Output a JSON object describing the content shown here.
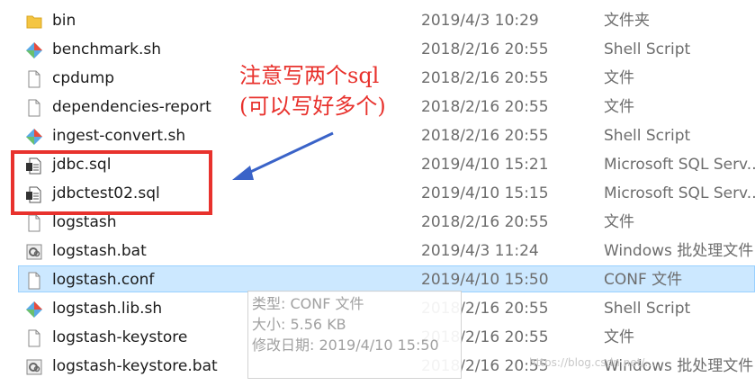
{
  "files": [
    {
      "name": "bin",
      "date": "2019/4/3 10:29",
      "type": "文件夹",
      "icon": "folder-icon"
    },
    {
      "name": "benchmark.sh",
      "date": "2018/2/16 20:55",
      "type": "Shell Script",
      "icon": "shell-script-icon"
    },
    {
      "name": "cpdump",
      "date": "2018/2/16 20:55",
      "type": "文件",
      "icon": "file-icon"
    },
    {
      "name": "dependencies-report",
      "date": "2018/2/16 20:55",
      "type": "文件",
      "icon": "file-icon"
    },
    {
      "name": "ingest-convert.sh",
      "date": "2018/2/16 20:55",
      "type": "Shell Script",
      "icon": "shell-script-icon"
    },
    {
      "name": "jdbc.sql",
      "date": "2019/4/10 15:21",
      "type": "Microsoft SQL Serv...",
      "icon": "sql-file-icon"
    },
    {
      "name": "jdbctest02.sql",
      "date": "2019/4/10 15:15",
      "type": "Microsoft SQL Serv...",
      "icon": "sql-file-icon"
    },
    {
      "name": "logstash",
      "date": "2018/2/16 20:55",
      "type": "文件",
      "icon": "file-icon"
    },
    {
      "name": "logstash.bat",
      "date": "2019/4/3 11:24",
      "type": "Windows 批处理文件",
      "icon": "batch-file-icon"
    },
    {
      "name": "logstash.conf",
      "date": "2019/4/10 15:50",
      "type": "CONF 文件",
      "icon": "file-icon",
      "selected": true
    },
    {
      "name": "logstash.lib.sh",
      "date": "2018/2/16 20:55",
      "type": "Shell Script",
      "icon": "shell-script-icon"
    },
    {
      "name": "logstash-keystore",
      "date": "2018/2/16 20:55",
      "type": "文件",
      "icon": "file-icon"
    },
    {
      "name": "logstash-keystore.bat",
      "date": "2018/2/16 20:55",
      "type": "Windows 批处理文件",
      "icon": "batch-file-icon"
    }
  ],
  "annotation": {
    "line1": "注意写两个sql",
    "line2": "(可以写好多个)"
  },
  "tooltip": {
    "type": "类型: CONF 文件",
    "size": "大小: 5.56 KB",
    "modified": "修改日期: 2019/4/10 15:50"
  },
  "watermark": "https://blog.csdn.net/...",
  "colors": {
    "annotation": "#e8322d",
    "selection": "#cce8ff",
    "arrow": "#3a63c8"
  }
}
